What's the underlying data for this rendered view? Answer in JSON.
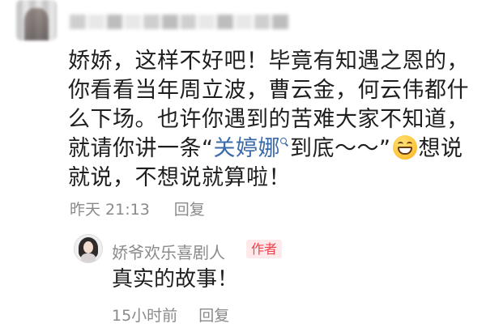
{
  "comment": {
    "avatar_icon": "blurred-user-avatar",
    "text_before": "娇娇，这样不好吧！毕竟有知遇之恩的，你看看当年周立波，曹云金，何云伟都什么下场。也许你遇到的苦难大家不知道，就请你讲一条“",
    "mention": "关婷娜",
    "text_after": "到底～～”",
    "emoji": "grinning-face-emoji",
    "text_end": "想说就说，不想说就算啦！",
    "time": "昨天 21:13",
    "reply_label": "回复"
  },
  "reply": {
    "avatar_icon": "author-avatar",
    "username": "娇爷欢乐喜剧人",
    "author_badge": "作者",
    "text": "真实的故事！",
    "time": "15小时前",
    "reply_label": "回复"
  },
  "colors": {
    "mention": "#3b6aa8",
    "badge_text": "#f0424b",
    "badge_bg": "#ffe9ea",
    "meta": "#8a8a8a"
  }
}
